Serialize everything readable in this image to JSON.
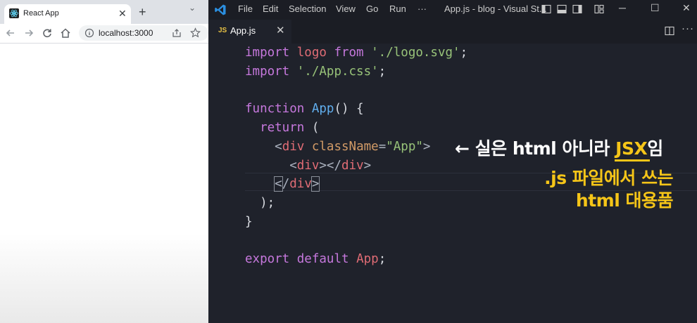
{
  "browser": {
    "tab_title": "React App",
    "tab_close": "✕",
    "new_tab": "+",
    "tab_menu": "⌄",
    "url": "localhost:3000"
  },
  "vscode": {
    "menu": [
      "File",
      "Edit",
      "Selection",
      "View",
      "Go",
      "Run",
      "···"
    ],
    "window_title": "App.js - blog - Visual St...",
    "tab_badge": "JS",
    "tab_name": "App.js",
    "tab_close": "✕",
    "more_actions": "···",
    "window_buttons": {
      "minimize": "─",
      "maximize": "☐",
      "close": "✕"
    }
  },
  "code": {
    "line1": {
      "kw1": "import",
      "name": " logo ",
      "kw2": "from",
      "sp": " ",
      "str": "'./logo.svg'",
      "end": ";"
    },
    "line2": {
      "kw1": "import",
      "sp": " ",
      "str": "'./App.css'",
      "end": ";"
    },
    "line3": {
      "kw": "function",
      "sp": " ",
      "fn": "App",
      "rest": "() {"
    },
    "line4": {
      "indent": "  ",
      "kw": "return",
      "rest": " ("
    },
    "line5": {
      "indent": "    ",
      "lt": "<",
      "tag": "div",
      "sp": " ",
      "attr": "className",
      "eq": "=",
      "str": "\"App\"",
      "gt": ">"
    },
    "line6": {
      "indent": "      ",
      "lt": "<",
      "tag": "div",
      "mid": "></",
      "tag2": "div",
      "gt": ">"
    },
    "line7": {
      "indent": "    ",
      "lt": "<",
      "slash": "/",
      "tag": "div",
      "gt": ">"
    },
    "line8": {
      "text": "  );"
    },
    "line9": {
      "text": "}"
    },
    "line10": {
      "kw1": "export",
      "sp": " ",
      "kw2": "default",
      "sp2": " ",
      "name": "App",
      "end": ";"
    }
  },
  "annotations": {
    "note1_prefix": "← 실은 html 아니라 ",
    "note1_highlight": "JSX",
    "note1_suffix": "임",
    "note2_line1": ".js 파일에서 쓰는",
    "note2_line2": "html 대용품"
  },
  "colors": {
    "editor_bg": "#1f222b",
    "keyword": "#c678dd",
    "string": "#98c379",
    "function": "#61afef",
    "tag": "#e06c75",
    "attribute": "#d19a66",
    "highlight": "#f5c518"
  }
}
